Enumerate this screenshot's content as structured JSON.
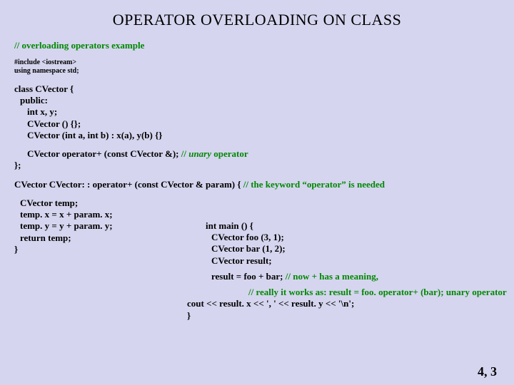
{
  "title": "OPERATOR OVERLOADING ON CLASS",
  "c1": "// overloading operators example",
  "inc1": "#include <iostream>",
  "inc2": "using namespace std;",
  "cls1": "class  CVector {",
  "cls2": "public:",
  "cls3": "int  x, y;",
  "cls4": "CVector () {};",
  "cls5": "CVector (int  a, int  b) : x(a), y(b) {}",
  "op_pre": "CVector  ",
  "op_kw": "operator+",
  "op_post": "  (const  CVector &);",
  "op_c1": "   // ",
  "op_c2": "unary",
  "op_c3": " operator",
  "cls_end": "};",
  "def_pre": "CVector  CVector: : ",
  "def_kw": "operator+",
  "def_post": "  (const  CVector & param) {",
  "def_c": "   // the keyword “operator” is needed",
  "d2": "CVector  temp;",
  "d3": "temp. x = x + param. x;",
  "d4": "temp. y = y + param. y;",
  "d5": "return  temp;",
  "d6": "}",
  "m1": "int main () {",
  "m2": "CVector  foo (3, 1);",
  "m3": "CVector  bar (1, 2);",
  "m4": "CVector  result;",
  "m5a": "result = foo + bar;",
  "m5b": "   // now + has a meaning,",
  "m6a": "// really it works as:  result = foo. ",
  "m6k": "operator+",
  "m6b": "  (bar);  unary operator",
  "m7": "cout << result. x << ', ' << result. y << '\\n';",
  "m8": "}",
  "out": "4, 3"
}
